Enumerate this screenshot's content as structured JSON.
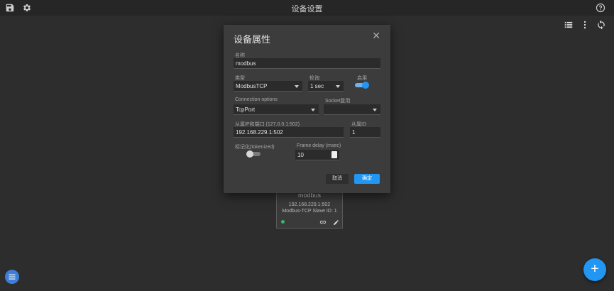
{
  "window": {
    "title": "设备设置"
  },
  "toolbar": {
    "icons": [
      "save-icon",
      "gear-icon",
      "help-icon",
      "list-icon",
      "more-vert-icon",
      "sync-icon"
    ]
  },
  "dialog": {
    "title": "设备属性",
    "name_label": "名称",
    "name_value": "modbus",
    "type_label": "类型",
    "type_value": "ModbusTCP",
    "polling_label": "轮询",
    "polling_value": "1 sec",
    "enable_label": "启用",
    "enabled": true,
    "conn_label": "Connection options",
    "conn_value": "TcpPort",
    "socket_label": "Socket复用",
    "socket_value": "",
    "ip_label": "从属IP和端口 (127.0.0.1:502)",
    "ip_value": "192.168.229.1:502",
    "slave_label": "从属ID",
    "slave_value": "1",
    "tokenized_label": "标记化(tokenized)",
    "tokenized": false,
    "frame_label": "Frame delay (msec)",
    "frame_value": "10",
    "cancel_label": "取消",
    "ok_label": "确定"
  },
  "node": {
    "name": "modbus",
    "address": "192.168.229.1:502",
    "slave": "Modbus-TCP Slave ID: 1",
    "status_color": "#3cb371"
  },
  "colors": {
    "accent": "#2196f3"
  }
}
